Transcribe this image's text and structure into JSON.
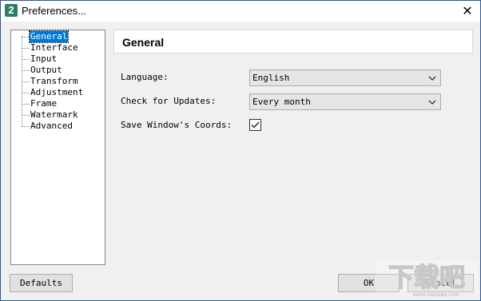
{
  "window": {
    "title": "Preferences..."
  },
  "titlebar": {
    "app_icon_glyph": "2",
    "close_glyph": "✕"
  },
  "tree": {
    "items": [
      {
        "label": "General",
        "selected": true
      },
      {
        "label": "Interface"
      },
      {
        "label": "Input"
      },
      {
        "label": "Output"
      },
      {
        "label": "Transform"
      },
      {
        "label": "Adjustment"
      },
      {
        "label": "Frame"
      },
      {
        "label": "Watermark"
      },
      {
        "label": "Advanced"
      }
    ]
  },
  "panel": {
    "title": "General",
    "language": {
      "label": "Language:",
      "value": "English"
    },
    "updates": {
      "label": "Check for Updates:",
      "value": "Every month"
    },
    "save_coords": {
      "label": "Save Window's Coords:",
      "checked": true
    }
  },
  "buttons": {
    "defaults": "Defaults",
    "ok": "OK",
    "cancel": "Cancel"
  },
  "watermark": {
    "logo_text": "下载吧",
    "url": "www.xiazaiba.com"
  },
  "colors": {
    "selection": "#0078d7",
    "window_border": "#2b579a",
    "app_icon": "#2e7d6a"
  }
}
